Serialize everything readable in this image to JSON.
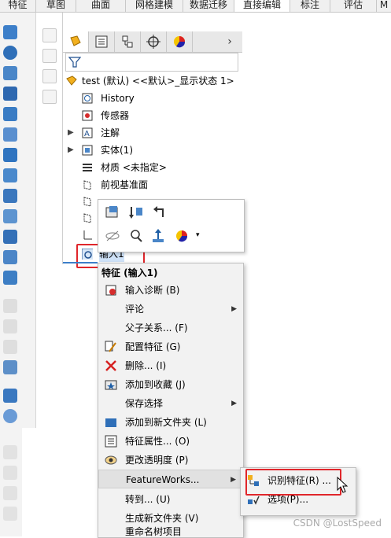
{
  "tabs": [
    "特征",
    "草图",
    "曲面",
    "网格建模",
    "数据迁移",
    "直接编辑",
    "标注",
    "评估",
    "M"
  ],
  "active_tab": "直接编辑",
  "tree": {
    "root": "test (默认) <<默认>_显示状态 1>",
    "items": [
      {
        "label": "History",
        "icon": "history-icon"
      },
      {
        "label": "传感器",
        "icon": "sensor-icon"
      },
      {
        "label": "注解",
        "icon": "annotation-icon"
      },
      {
        "label": "实体(1)",
        "icon": "solid-bodies-icon"
      },
      {
        "label": "材质 <未指定>",
        "icon": "material-icon"
      },
      {
        "label": "前视基准面",
        "icon": "plane-icon"
      }
    ],
    "selected": "输入1"
  },
  "menu": {
    "title": "特征 (输入1)",
    "items": [
      {
        "label": "输入诊断 (B)",
        "icon": "import-diagnostics-icon"
      },
      {
        "label": "评论",
        "submenu": true
      },
      {
        "label": "父子关系... (F)"
      },
      {
        "label": "配置特征 (G)",
        "icon": "configure-feature-icon"
      },
      {
        "label": "删除... (I)",
        "icon": "delete-icon"
      },
      {
        "label": "添加到收藏 (J)",
        "icon": "favorite-icon"
      },
      {
        "label": "保存选择",
        "submenu": true
      },
      {
        "label": "添加到新文件夹 (L)",
        "icon": "folder-icon"
      },
      {
        "label": "特征属性... (O)",
        "icon": "properties-icon"
      },
      {
        "label": "更改透明度 (P)",
        "icon": "transparency-icon"
      },
      {
        "label": "FeatureWorks...",
        "submenu": true
      },
      {
        "label": "转到... (U)"
      },
      {
        "label": "生成新文件夹 (V)"
      },
      {
        "label": "重命名树项目"
      }
    ]
  },
  "submenu": {
    "items": [
      {
        "label": "识别特征(R) ...",
        "icon": "recognize-features-icon"
      },
      {
        "label": "选项(P)...",
        "icon": "options-icon"
      }
    ]
  },
  "watermark": "CSDN @LostSpeed",
  "colors": {
    "highlight_red": "#e0262b",
    "tab_active": "#ffffff",
    "panel": "#f2f2f2"
  }
}
